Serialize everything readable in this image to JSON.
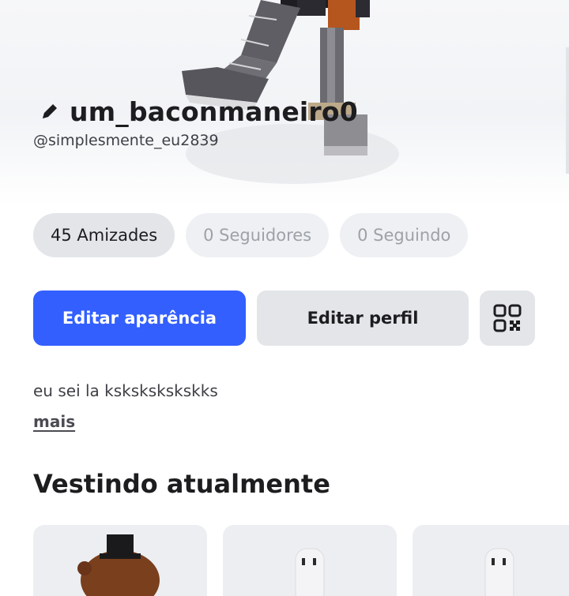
{
  "profile": {
    "display_name": "um_baconmaneiro0",
    "handle": "@simplesmente_eu2839",
    "bio": "eu sei la kskskskskskks",
    "more_label": "mais"
  },
  "stats": {
    "friends": "45 Amizades",
    "followers": "0 Seguidores",
    "following": "0 Seguindo"
  },
  "actions": {
    "edit_avatar": "Editar aparência",
    "edit_profile": "Editar perfil"
  },
  "wearing": {
    "title": "Vestindo atualmente",
    "items": [
      {
        "icon": "bear-hat-item"
      },
      {
        "icon": "white-head-item"
      },
      {
        "icon": "white-head-item"
      }
    ]
  },
  "colors": {
    "primary": "#335fff",
    "pill_bg": "#e3e5e9",
    "text": "#1d1d1f"
  },
  "icons": [
    "pencil-icon",
    "qr-code-icon"
  ]
}
